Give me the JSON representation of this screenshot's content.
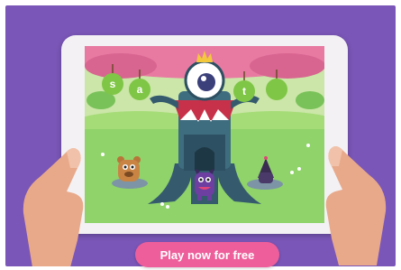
{
  "promo": {
    "cta_label": "Play now for free"
  },
  "game": {
    "apple_letters": [
      "s",
      "a",
      "t"
    ]
  },
  "colors": {
    "background": "#7a56b8",
    "cta": "#ee5e9a",
    "grass": "#8fd36a",
    "tree_trunk": "#355a6e",
    "apple": "#7fc646"
  }
}
